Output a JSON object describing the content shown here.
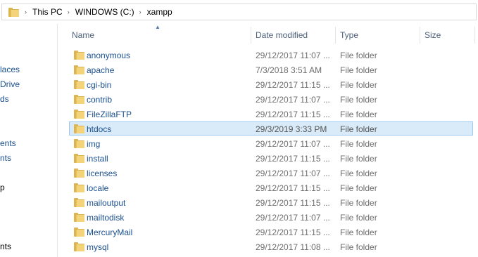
{
  "breadcrumb": [
    "This PC",
    "WINDOWS (C:)",
    "xampp"
  ],
  "breadcrumb_separator": "›",
  "nav_items": [
    "laces",
    "Drive",
    "ds",
    "ents",
    "nts",
    "p",
    "nts"
  ],
  "columns": {
    "name": "Name",
    "date": "Date modified",
    "type": "Type",
    "size": "Size"
  },
  "rows": [
    {
      "name": "anonymous",
      "date": "29/12/2017 11:07 ...",
      "type": "File folder"
    },
    {
      "name": "apache",
      "date": "7/3/2018 3:51 AM",
      "type": "File folder"
    },
    {
      "name": "cgi-bin",
      "date": "29/12/2017 11:15 ...",
      "type": "File folder"
    },
    {
      "name": "contrib",
      "date": "29/12/2017 11:07 ...",
      "type": "File folder"
    },
    {
      "name": "FileZillaFTP",
      "date": "29/12/2017 11:15 ...",
      "type": "File folder"
    },
    {
      "name": "htdocs",
      "date": "29/3/2019 3:33 PM",
      "type": "File folder",
      "selected": true
    },
    {
      "name": "img",
      "date": "29/12/2017 11:07 ...",
      "type": "File folder"
    },
    {
      "name": "install",
      "date": "29/12/2017 11:15 ...",
      "type": "File folder"
    },
    {
      "name": "licenses",
      "date": "29/12/2017 11:07 ...",
      "type": "File folder"
    },
    {
      "name": "locale",
      "date": "29/12/2017 11:15 ...",
      "type": "File folder"
    },
    {
      "name": "mailoutput",
      "date": "29/12/2017 11:15 ...",
      "type": "File folder"
    },
    {
      "name": "mailtodisk",
      "date": "29/12/2017 11:07 ...",
      "type": "File folder"
    },
    {
      "name": "MercuryMail",
      "date": "29/12/2017 11:15 ...",
      "type": "File folder"
    },
    {
      "name": "mysql",
      "date": "29/12/2017 11:08 ...",
      "type": "File folder"
    }
  ],
  "colors": {
    "accent": "#1a4f8f",
    "selected_bg": "#d9ebf9",
    "selected_border": "#99c9ef",
    "folder": "#f4d47a"
  },
  "icons": {
    "folder": "folder-icon",
    "sort": "sort-up-icon",
    "separator": "chevron-right-icon"
  }
}
